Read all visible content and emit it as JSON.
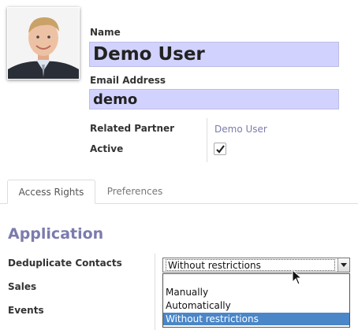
{
  "user": {
    "name_label": "Name",
    "name_value": "Demo User",
    "email_label": "Email Address",
    "email_value": "demo",
    "related_partner_label": "Related Partner",
    "related_partner_value": "Demo User",
    "active_label": "Active",
    "active_checked": true
  },
  "tabs": [
    {
      "label": "Access Rights",
      "active": true
    },
    {
      "label": "Preferences",
      "active": false
    }
  ],
  "application": {
    "title": "Application",
    "rows": [
      {
        "label": "Deduplicate Contacts"
      },
      {
        "label": "Sales"
      },
      {
        "label": "Events"
      }
    ],
    "select": {
      "selected": "Without restrictions",
      "options": [
        "Manually",
        "Automatically",
        "Without restrictions"
      ]
    }
  },
  "colors": {
    "field_bg": "#d2d2ff",
    "link": "#7c7bad",
    "highlight": "#4a86c8"
  },
  "icons": [
    "avatar-photo",
    "check-icon",
    "dropdown-arrow-icon",
    "mouse-cursor-icon"
  ]
}
